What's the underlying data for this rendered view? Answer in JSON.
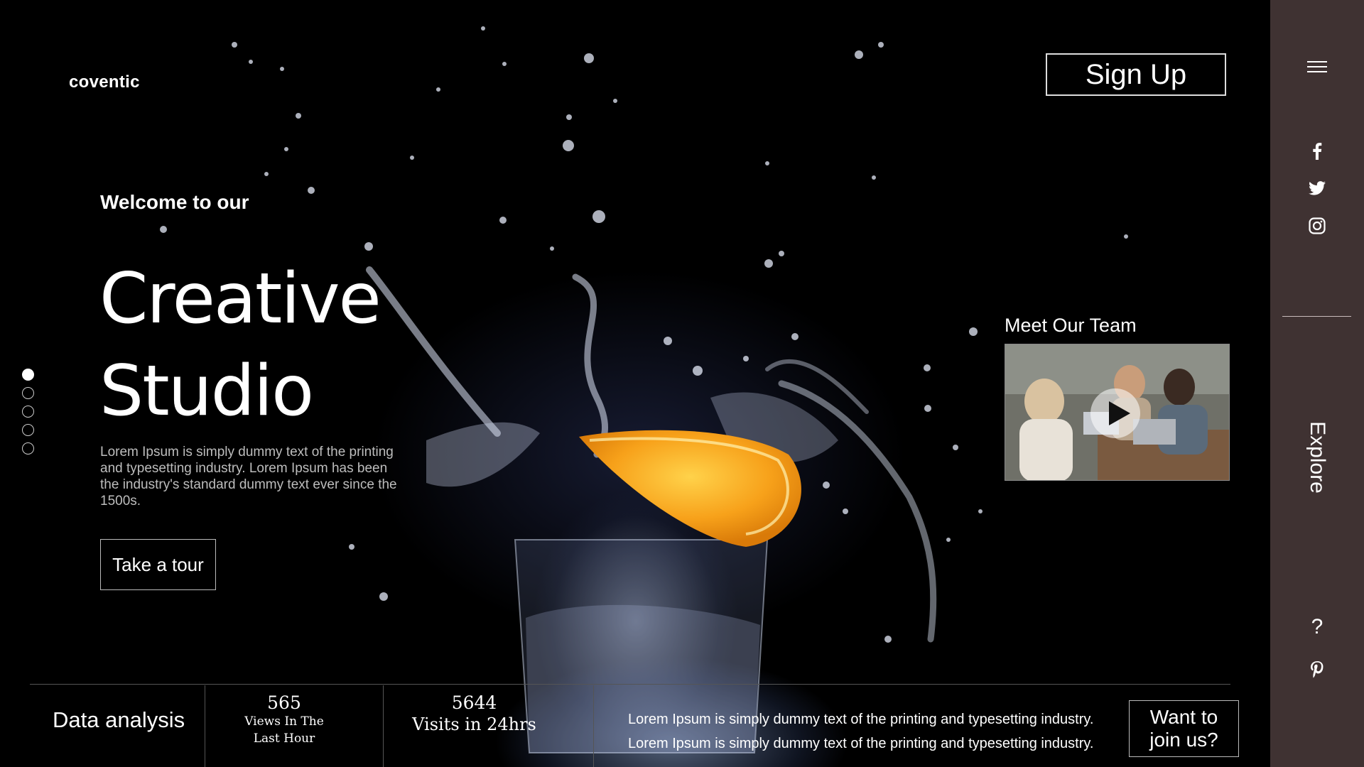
{
  "brand": {
    "logo": "coventic"
  },
  "header": {
    "signup_label": "Sign Up"
  },
  "hero": {
    "welcome": "Welcome to our",
    "title_line1": "Creative",
    "title_line2": "Studio",
    "description": "Lorem Ipsum is simply dummy text of the printing and typesetting industry. Lorem Ipsum has been the industry's standard dummy text ever since the 1500s.",
    "cta_label": "Take a tour",
    "slides": {
      "count": 5,
      "active": 1
    }
  },
  "team": {
    "title": "Meet Our Team"
  },
  "stats_bar": {
    "title": "Data analysis",
    "stat1": {
      "value": "565",
      "label_line1": "Views In The",
      "label_line2": "Last Hour"
    },
    "stat2": {
      "value": "5644",
      "label": "Visits in 24hrs"
    },
    "text_line1": "Lorem Ipsum is simply dummy text of the printing and typesetting industry.",
    "text_line2": "Lorem Ipsum is simply dummy text of the printing and typesetting industry.",
    "join_line1": "Want to",
    "join_line2": "join us?"
  },
  "sidebar": {
    "menu_icon": "hamburger-icon",
    "social": [
      "facebook-icon",
      "twitter-icon",
      "instagram-icon"
    ],
    "explore_label": "Explore",
    "help_label": "?",
    "pinterest_icon": "pinterest-icon"
  },
  "colors": {
    "sidebar_bg": "#3f3232",
    "orange": "#f7a11a",
    "page_bg": "#000000"
  }
}
